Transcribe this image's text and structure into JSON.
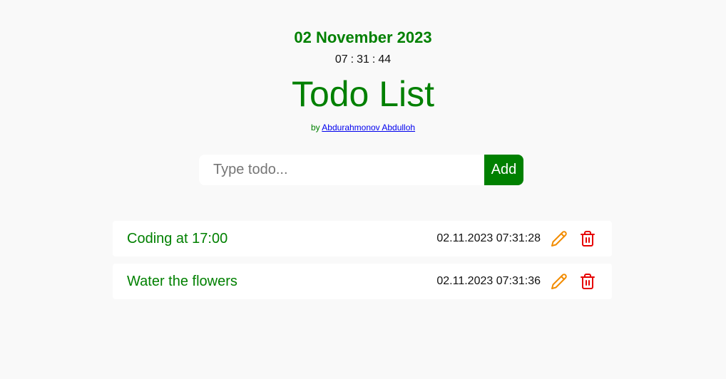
{
  "header": {
    "date": "02 November 2023",
    "clock": {
      "hours": "07",
      "minutes": "31",
      "seconds": "44",
      "separator": ":"
    },
    "title": "Todo List",
    "byline_prefix": "by",
    "author": "Abdurahmonov Abdulloh"
  },
  "form": {
    "placeholder": "Type todo...",
    "value": "",
    "add_label": "Add"
  },
  "todos": [
    {
      "text": "Coding at 17:00",
      "time": "02.11.2023 07:31:28",
      "edit_icon": "pencil-icon",
      "delete_icon": "trash-icon"
    },
    {
      "text": "Water the flowers",
      "time": "02.11.2023 07:31:36",
      "edit_icon": "pencil-icon",
      "delete_icon": "trash-icon"
    }
  ],
  "colors": {
    "accent": "#008000",
    "edit": "#f28c00",
    "delete": "#e60000",
    "link": "#0000ee",
    "background": "#f9f9f9"
  }
}
